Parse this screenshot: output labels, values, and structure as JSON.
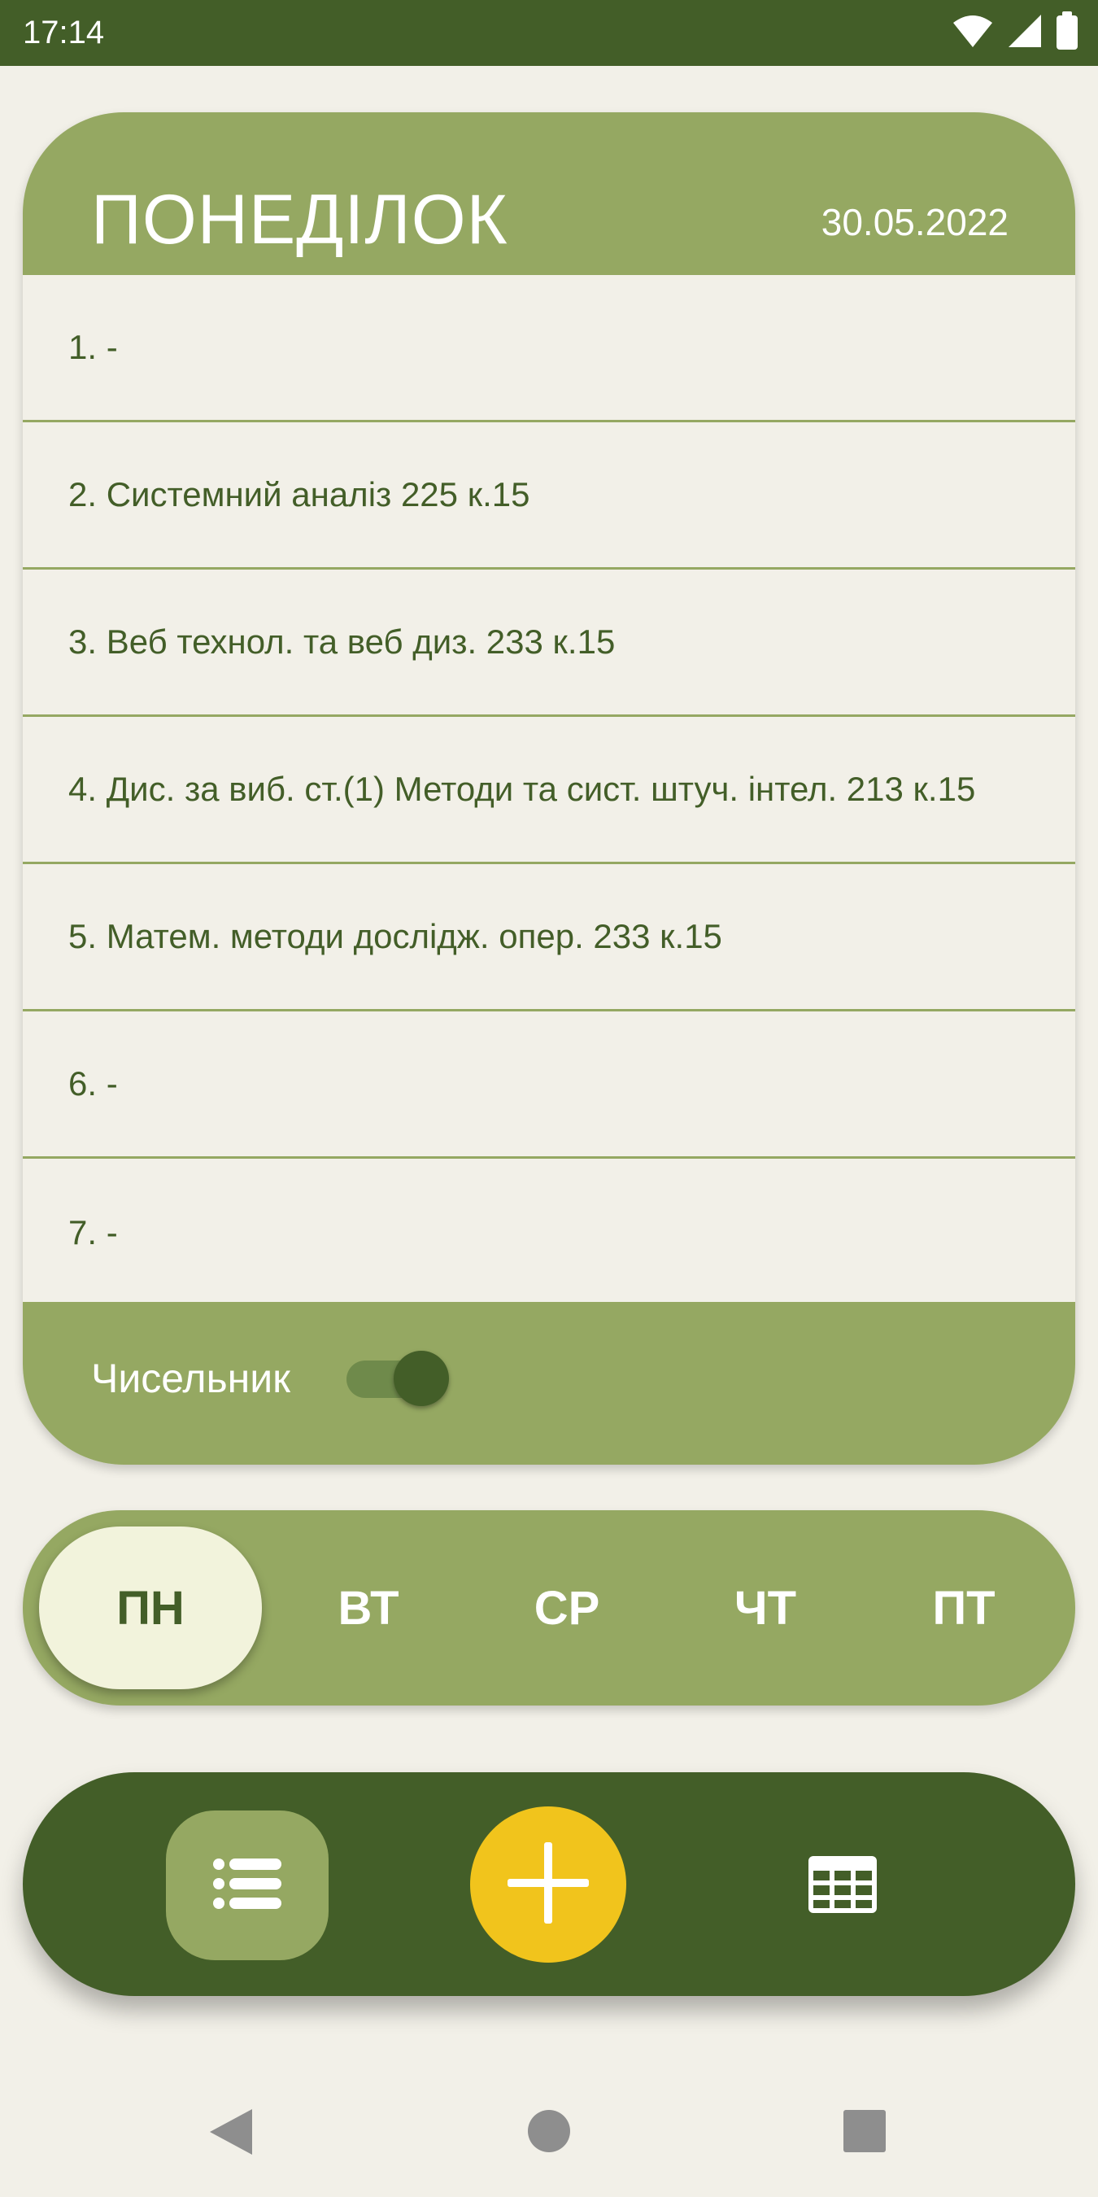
{
  "status_bar": {
    "time": "17:14",
    "icons": [
      "wifi-icon",
      "cellular-signal-icon",
      "battery-icon"
    ]
  },
  "day_card": {
    "day_name": "ПОНЕДІЛОК",
    "date": "30.05.2022",
    "lessons": [
      "1.  -",
      "2. Системний аналіз  225 к.15",
      "3. Веб технол. та веб диз.  233 к.15",
      "4. Дис. за виб. ст.(1) Методи та сист. штуч. інтел.  213 к.15",
      "5. Матем. методи дослідж. опер. 233 к.15",
      "6.  -",
      "7.  -"
    ],
    "week_toggle": {
      "label": "Чисельник",
      "checked": true
    }
  },
  "weekdays": {
    "items": [
      "ПН",
      "ВТ",
      "СР",
      "ЧТ",
      "ПТ"
    ],
    "selected": "ПН"
  },
  "bottom_nav": {
    "items": [
      {
        "name": "list",
        "icon": "list-icon",
        "active": true
      },
      {
        "name": "add",
        "icon": "plus-icon",
        "active": false
      },
      {
        "name": "calendar",
        "icon": "calendar-grid-icon",
        "active": false
      }
    ]
  },
  "system_nav": {
    "icons": [
      "back-triangle-icon",
      "home-circle-icon",
      "recents-square-icon"
    ]
  },
  "colors": {
    "dark_green": "#435e28",
    "light_green": "#95a862",
    "background": "#f2f0e8",
    "accent_yellow": "#f1c41c",
    "selected_day_bg": "#f2f3dc"
  }
}
